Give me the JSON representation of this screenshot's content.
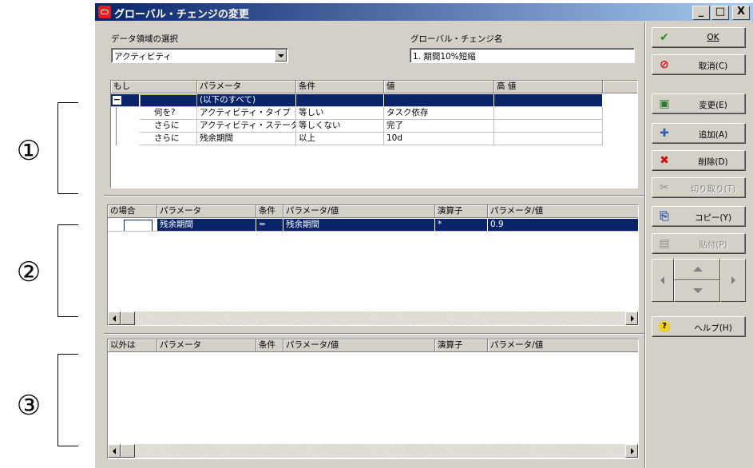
{
  "annotations": {
    "one": "①",
    "two": "②",
    "three": "③"
  },
  "window": {
    "title": "グローバル・チェンジの変更",
    "min": "_",
    "max": "□",
    "close": "X"
  },
  "data_area": {
    "label": "データ領域の選択",
    "value": "アクティビティ"
  },
  "change_name": {
    "label": "グローバル・チェンジ名",
    "value": "1. 期間10%短縮"
  },
  "grid1": {
    "headers": [
      "もし",
      "パラメータ",
      "条件",
      "値",
      "高 値"
    ],
    "rows": [
      {
        "c0": "",
        "c1": "(以下のすべて)",
        "c2": "",
        "c3": "",
        "c4": ""
      },
      {
        "c0": "何を?",
        "c1": "アクティビティ・タイプ",
        "c2": "等しい",
        "c3": "タスク依存",
        "c4": ""
      },
      {
        "c0": "さらに",
        "c1": "アクティビティ・ステータス",
        "c2": "等しくない",
        "c3": "完了",
        "c4": ""
      },
      {
        "c0": "さらに",
        "c1": "残余期間",
        "c2": "以上",
        "c3": "10d",
        "c4": ""
      }
    ],
    "collapse": "−"
  },
  "grid2": {
    "headers": [
      "の場合",
      "パラメータ",
      "条件",
      "パラメータ/値",
      "演算子",
      "パラメータ/値"
    ],
    "rows": [
      {
        "c0": "",
        "c1": "残余期間",
        "c2": "=",
        "c3": "残余期間",
        "c4": "*",
        "c5": "0.9"
      }
    ]
  },
  "grid3": {
    "headers": [
      "以外は",
      "パラメータ",
      "条件",
      "パラメータ/値",
      "演算子",
      "パラメータ/値"
    ]
  },
  "buttons": {
    "ok": "OK",
    "cancel": "取消(C)",
    "change": "変更(E)",
    "add": "追加(A)",
    "delete": "削除(D)",
    "cut": "切り取り(T)",
    "copy": "コピー(Y)",
    "paste": "貼付(P)",
    "help": "ヘルプ(H)"
  },
  "colors": {
    "selection": "#0a246a",
    "titlebar": "#0a246a",
    "face": "#d4d0c8"
  }
}
